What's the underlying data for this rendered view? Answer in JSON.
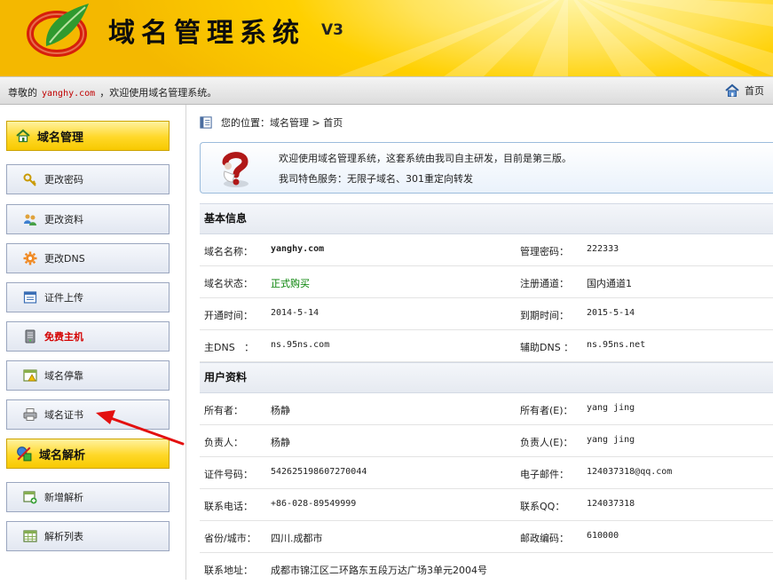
{
  "header": {
    "title": "域名管理系统",
    "version": "V3",
    "logo_icon": "leaf-logo-icon",
    "colors": {
      "bg": "#ffd000",
      "logo_red": "#d61f0b",
      "logo_green": "#2f9a2f"
    }
  },
  "welcome_bar": {
    "prefix": "尊敬的",
    "domain": "yanghy.com",
    "suffix": "，欢迎使用域名管理系统。",
    "home_label": "首页",
    "home_icon": "house-icon"
  },
  "sidebar": {
    "section1": {
      "label": "域名管理",
      "icon": "house-icon"
    },
    "items1": [
      {
        "label": "更改密码",
        "icon": "key-icon"
      },
      {
        "label": "更改资料",
        "icon": "users-icon"
      },
      {
        "label": "更改DNS",
        "icon": "gear-icon"
      },
      {
        "label": "证件上传",
        "icon": "document-icon"
      },
      {
        "label": "免费主机",
        "icon": "server-icon",
        "color": "#d40000"
      },
      {
        "label": "域名停靠",
        "icon": "warning-window-icon"
      },
      {
        "label": "域名证书",
        "icon": "printer-icon"
      }
    ],
    "section2": {
      "label": "域名解析",
      "icon": "analysis-icon"
    },
    "items2": [
      {
        "label": "新增解析",
        "icon": "add-window-icon"
      },
      {
        "label": "解析列表",
        "icon": "grid-list-icon"
      }
    ]
  },
  "breadcrumb": {
    "text": "您的位置：域名管理 > 首页",
    "icon": "page-icon"
  },
  "notice": {
    "line1": "欢迎使用域名管理系统，这套系统由我司自主研发，目前是第三版。",
    "line2": "我司特色服务：无限子域名、301重定向转发",
    "icon": "question-mark-icon"
  },
  "basic_info": {
    "title": "基本信息",
    "rows": [
      {
        "l1": "域名名称：",
        "v1": "yanghy.com",
        "l2": "管理密码：",
        "v2": "222333"
      },
      {
        "l1": "域名状态：",
        "v1": "正式购买",
        "l2": "注册通道：",
        "v2": "国内通道1"
      },
      {
        "l1": "开通时间：",
        "v1": "2014-5-14",
        "l2": "到期时间：",
        "v2": "2015-5-14"
      },
      {
        "l1": "主DNS   ：",
        "v1": "ns.95ns.com",
        "l2": "辅助DNS ：",
        "v2": "ns.95ns.net"
      }
    ]
  },
  "user_info": {
    "title": "用户资料",
    "rows": [
      {
        "l1": "所有者：",
        "v1": "杨静",
        "l2": "所有者(E)：",
        "v2": "yang jing"
      },
      {
        "l1": "负责人：",
        "v1": "杨静",
        "l2": "负责人(E)：",
        "v2": "yang jing"
      },
      {
        "l1": "证件号码：",
        "v1": "542625198607270044",
        "l2": "电子邮件：",
        "v2": "124037318@qq.com"
      },
      {
        "l1": "联系电话：",
        "v1": "+86-028-89549999",
        "l2": "联系QQ：",
        "v2": "124037318"
      },
      {
        "l1": "省份/城市：",
        "v1": "四川.成都市",
        "l2": "邮政编码：",
        "v2": "610000"
      },
      {
        "l1": "联系地址：",
        "v1": "成都市锦江区二环路东五段万达广场3单元2004号",
        "l2": "",
        "v2": ""
      }
    ]
  },
  "annotation": {
    "arrow_color": "#e31010",
    "points_to": "域名证书"
  }
}
